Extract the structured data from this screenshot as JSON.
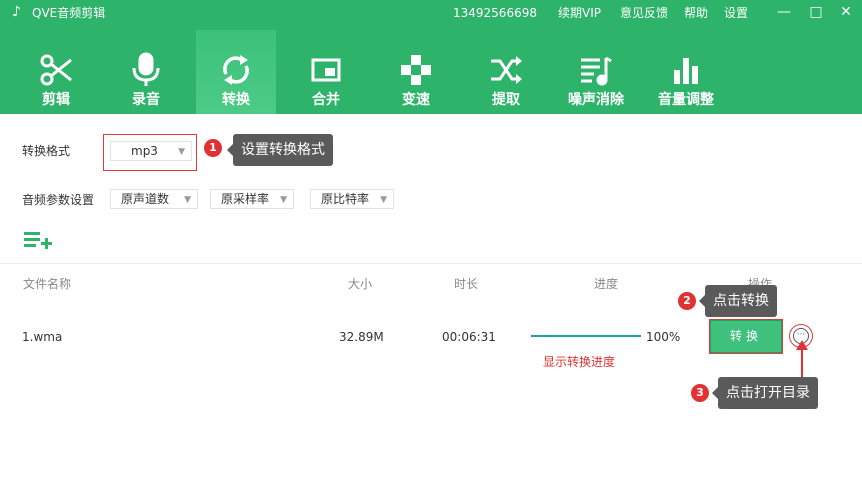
{
  "app": {
    "title": "QVE音频剪辑",
    "phone": "13492566698",
    "vip": "续期VIP",
    "feedback": "意见反馈",
    "help": "帮助",
    "settings": "设置"
  },
  "window_controls": {
    "minimize": "—",
    "maximize": "□",
    "close": "✕"
  },
  "toolbar": {
    "items": [
      {
        "label": "剪辑",
        "icon": "scissors-icon"
      },
      {
        "label": "录音",
        "icon": "microphone-icon"
      },
      {
        "label": "转换",
        "icon": "convert-icon"
      },
      {
        "label": "合并",
        "icon": "merge-icon"
      },
      {
        "label": "变速",
        "icon": "speed-icon"
      },
      {
        "label": "提取",
        "icon": "extract-icon"
      },
      {
        "label": "噪声消除",
        "icon": "noise-icon"
      },
      {
        "label": "音量调整",
        "icon": "volume-icon"
      }
    ],
    "active_index": 2
  },
  "settings": {
    "format_label": "转换格式",
    "format_value": "mp3",
    "params_label": "音频参数设置",
    "channels": "原声道数",
    "sample_rate": "原采样率",
    "bitrate": "原比特率"
  },
  "annotations": {
    "step1": {
      "num": "1",
      "text": "设置转换格式"
    },
    "step2": {
      "num": "2",
      "text": "点击转换"
    },
    "step3": {
      "num": "3",
      "text": "点击打开目录"
    },
    "progress_note": "显示转换进度"
  },
  "table": {
    "headers": {
      "name": "文件名称",
      "size": "大小",
      "duration": "时长",
      "progress": "进度",
      "action": "操作"
    },
    "rows": [
      {
        "name": "1.wma",
        "size": "32.89M",
        "duration": "00:06:31",
        "progress_text": "100%",
        "progress": 1.0,
        "convert_label": "转换",
        "folder_icon": "more-icon"
      }
    ]
  },
  "colors": {
    "brand": "#2db36a",
    "progress": "#1aa5a0",
    "annotation": "#e03232",
    "tooltip": "#5a5a5a"
  }
}
